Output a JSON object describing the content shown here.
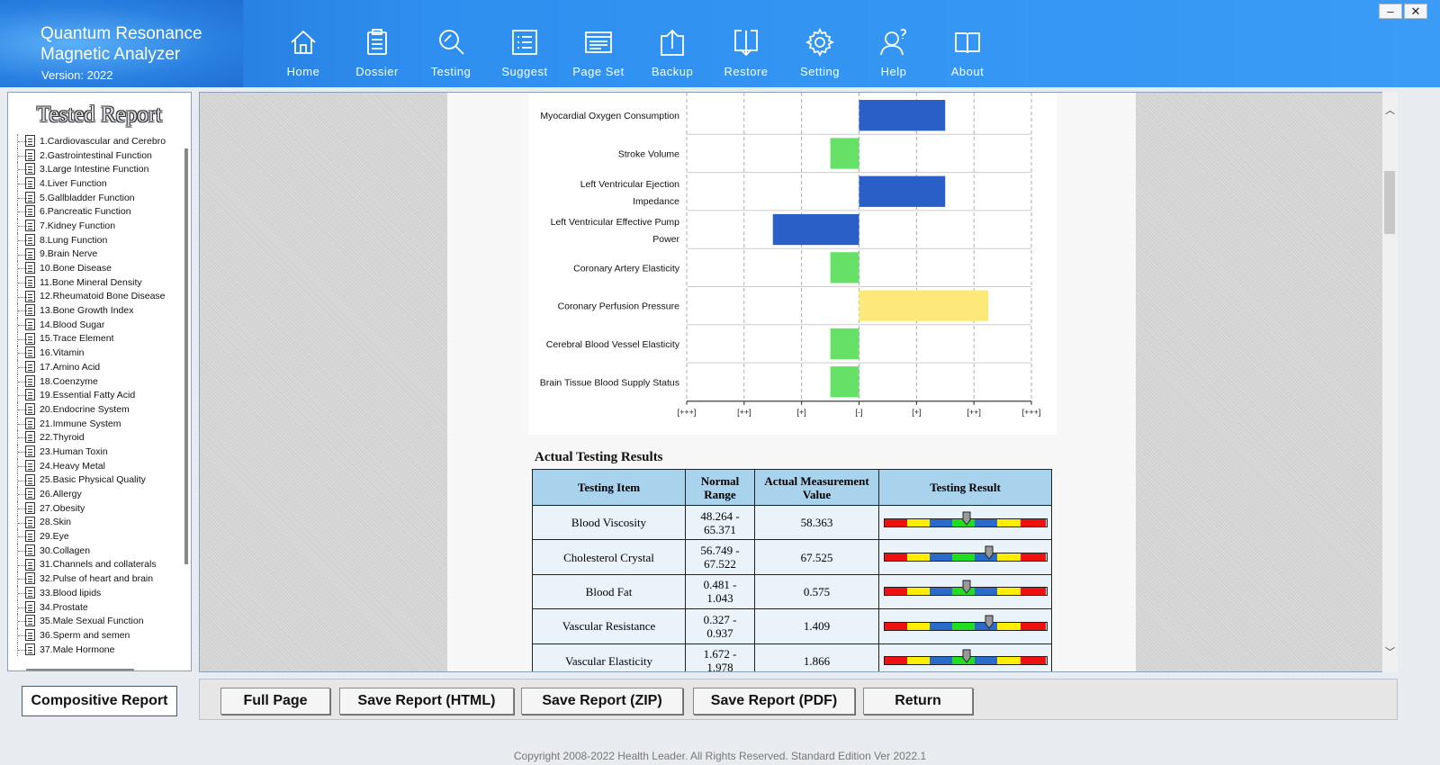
{
  "app": {
    "title_line1": "Quantum Resonance",
    "title_line2": "Magnetic Analyzer",
    "version": "Version: 2022"
  },
  "window_controls": {
    "minimize": "–",
    "close": "✕"
  },
  "nav": [
    {
      "label": "Home",
      "icon": "home-icon"
    },
    {
      "label": "Dossier",
      "icon": "clipboard-icon"
    },
    {
      "label": "Testing",
      "icon": "magnifier-icon"
    },
    {
      "label": "Suggest",
      "icon": "list-icon"
    },
    {
      "label": "Page Set",
      "icon": "window-icon"
    },
    {
      "label": "Backup",
      "icon": "upload-icon"
    },
    {
      "label": "Restore",
      "icon": "download-icon"
    },
    {
      "label": "Setting",
      "icon": "gear-icon"
    },
    {
      "label": "Help",
      "icon": "user-help-icon"
    },
    {
      "label": "About",
      "icon": "book-icon"
    }
  ],
  "sidebar": {
    "title": "Tested Report",
    "items": [
      "1.Cardiovascular and Cerebro",
      "2.Gastrointestinal Function",
      "3.Large Intestine Function",
      "4.Liver Function",
      "5.Gallbladder Function",
      "6.Pancreatic Function",
      "7.Kidney Function",
      "8.Lung Function",
      "9.Brain Nerve",
      "10.Bone Disease",
      "11.Bone Mineral Density",
      "12.Rheumatoid Bone Disease",
      "13.Bone Growth Index",
      "14.Blood Sugar",
      "15.Trace Element",
      "16.Vitamin",
      "17.Amino Acid",
      "18.Coenzyme",
      "19.Essential Fatty Acid",
      "20.Endocrine System",
      "21.Immune System",
      "22.Thyroid",
      "23.Human Toxin",
      "24.Heavy Metal",
      "25.Basic Physical Quality",
      "26.Allergy",
      "27.Obesity",
      "28.Skin",
      "29.Eye",
      "30.Collagen",
      "31.Channels and collaterals",
      "32.Pulse of heart and brain",
      "33.Blood lipids",
      "34.Prostate",
      "35.Male Sexual Function",
      "36.Sperm and semen",
      "37.Male Hormone"
    ],
    "composite_button": "Compositive Report"
  },
  "chart_data": {
    "type": "bar",
    "orientation": "horizontal",
    "categories": [
      [
        "Myocardial Oxygen Consumption"
      ],
      [
        "Stroke Volume"
      ],
      [
        "Left Ventricular Ejection",
        "Impedance"
      ],
      [
        "Left Ventricular Effective Pump",
        "Power"
      ],
      [
        "Coronary Artery Elasticity"
      ],
      [
        "Coronary Perfusion Pressure"
      ],
      [
        "Cerebral Blood Vessel Elasticity"
      ],
      [
        "Brain Tissue Blood Supply Status"
      ]
    ],
    "values": [
      1.5,
      -0.5,
      1.5,
      -1.5,
      -0.5,
      2.25,
      -0.5,
      -0.5
    ],
    "colors": [
      "#2a5fc8",
      "#66e066",
      "#2a5fc8",
      "#2a5fc8",
      "#66e066",
      "#fde97a",
      "#66e066",
      "#66e066"
    ],
    "x_ticks": [
      "[+++]",
      "[++]",
      "[+]",
      "[-]",
      "[+]",
      "[++]",
      "[+++]"
    ],
    "xlim": [
      -3,
      3
    ],
    "grid": true
  },
  "results": {
    "title": "Actual Testing Results",
    "headers": [
      "Testing Item",
      "Normal Range",
      "Actual Measurement Value",
      "Testing Result"
    ],
    "rows": [
      {
        "item": "Blood Viscosity",
        "range": "48.264 - 65.371",
        "value": "58.363",
        "marker": 0.5
      },
      {
        "item": "Cholesterol Crystal",
        "range": "56.749 - 67.522",
        "value": "67.525",
        "marker": 0.64
      },
      {
        "item": "Blood Fat",
        "range": "0.481 - 1.043",
        "value": "0.575",
        "marker": 0.5
      },
      {
        "item": "Vascular Resistance",
        "range": "0.327 - 0.937",
        "value": "1.409",
        "marker": 0.64
      },
      {
        "item": "Vascular Elasticity",
        "range": "1.672 - 1.978",
        "value": "1.866",
        "marker": 0.5
      }
    ]
  },
  "bottom_buttons": [
    "Full Page",
    "Save Report (HTML)",
    "Save Report (ZIP)",
    "Save Report (PDF)",
    "Return"
  ],
  "copyright": "Copyright 2008-2022 Health Leader. All Rights Reserved.  Standard Edition Ver 2022.1"
}
